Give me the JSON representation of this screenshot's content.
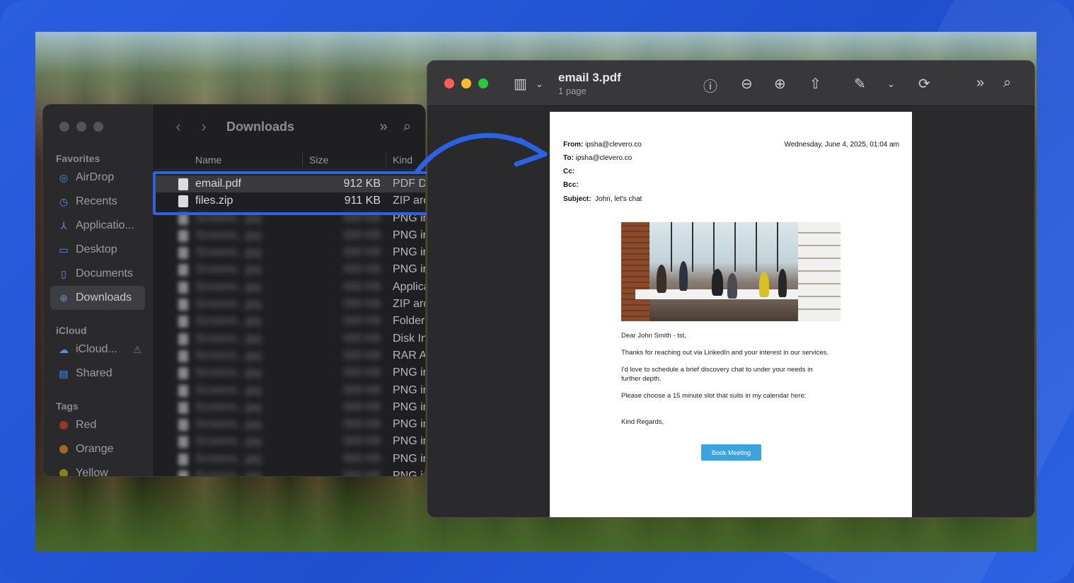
{
  "finder": {
    "title": "Downloads",
    "sidebar": {
      "favorites_label": "Favorites",
      "favorites": [
        {
          "label": "AirDrop",
          "icon": "airdrop-icon"
        },
        {
          "label": "Recents",
          "icon": "clock-icon"
        },
        {
          "label": "Applicatio...",
          "icon": "applications-icon"
        },
        {
          "label": "Desktop",
          "icon": "desktop-icon"
        },
        {
          "label": "Documents",
          "icon": "document-icon"
        },
        {
          "label": "Downloads",
          "icon": "download-icon",
          "active": true
        }
      ],
      "icloud_label": "iCloud",
      "icloud": [
        {
          "label": "iCloud...",
          "icon": "cloud-icon"
        },
        {
          "label": "Shared",
          "icon": "shared-folder-icon"
        }
      ],
      "tags_label": "Tags",
      "tags": [
        {
          "label": "Red",
          "color": "#e0443e"
        },
        {
          "label": "Orange",
          "color": "#e89a2c"
        },
        {
          "label": "Yellow",
          "color": "#d9c12e"
        }
      ]
    },
    "columns": {
      "name": "Name",
      "size": "Size",
      "kind": "Kind"
    },
    "files": [
      {
        "name": "email.pdf",
        "size": "912 KB",
        "kind": "PDF D"
      },
      {
        "name": "files.zip",
        "size": "911 KB",
        "kind": "ZIP arc"
      }
    ],
    "blurred_kinds": [
      "PNG ir",
      "PNG ir",
      "PNG ir",
      "PNG ir",
      "Applica",
      "ZIP arc",
      "Folder",
      "Disk In",
      "RAR A",
      "PNG ir",
      "PNG ir",
      "PNG ir",
      "PNG ir",
      "PNG ir",
      "PNG ir",
      "PNG i"
    ]
  },
  "preview": {
    "title": "email 3.pdf",
    "subtitle": "1 page",
    "email": {
      "from_label": "From:",
      "from": "ipsha@clevero.co",
      "date": "Wednesday, June 4, 2025, 01:04 am",
      "to_label": "To:",
      "to": "ipsha@clevero.co",
      "cc_label": "Cc:",
      "bcc_label": "Bcc:",
      "subject_label": "Subject:",
      "subject": "John, let's chat",
      "greeting": "Dear John Smith - tst,",
      "p1": "Thanks for reaching out via LinkedIn and your interest in our services.",
      "p2": "I'd love to schedule a brief discovery chat to under your needs in further depth.",
      "p3": "Please choose a 15 minute slot that suits in my calendar here:",
      "closing": "Kind Regards,",
      "button": "Book Meeting"
    }
  },
  "colors": {
    "accent": "#2b63e3",
    "book_button": "#3ba3de"
  }
}
